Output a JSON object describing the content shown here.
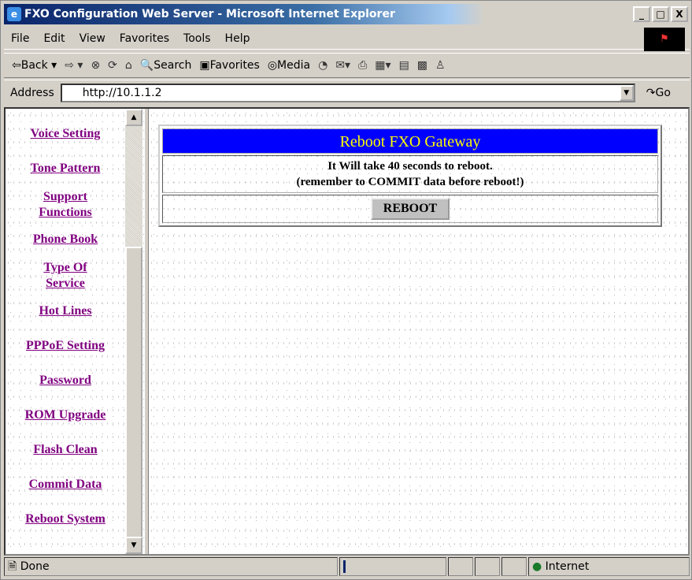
{
  "window": {
    "title": "FXO Configuration Web Server - Microsoft Internet Explorer",
    "controls": [
      "_",
      "□",
      "X"
    ]
  },
  "menu": [
    "File",
    "Edit",
    "View",
    "Favorites",
    "Tools",
    "Help"
  ],
  "toolbar": {
    "back": "Back",
    "search": "Search",
    "favorites": "Favorites",
    "media": "Media"
  },
  "address": {
    "label": "Address",
    "value": "http://10.1.1.2",
    "go": "Go"
  },
  "nav": [
    "Voice Setting",
    "Tone Pattern",
    "Support Functions",
    "Phone Book",
    "Type Of Service",
    "Hot Lines",
    "PPPoE Setting",
    "Password",
    "ROM Upgrade",
    "Flash Clean",
    "Commit Data",
    "Reboot System"
  ],
  "panel": {
    "title": "Reboot FXO Gateway",
    "line1": "It Will take 40 seconds to reboot.",
    "line2": "(remember to COMMIT data before reboot!)",
    "button": "REBOOT"
  },
  "status": {
    "text": "Done",
    "zone": "Internet"
  }
}
